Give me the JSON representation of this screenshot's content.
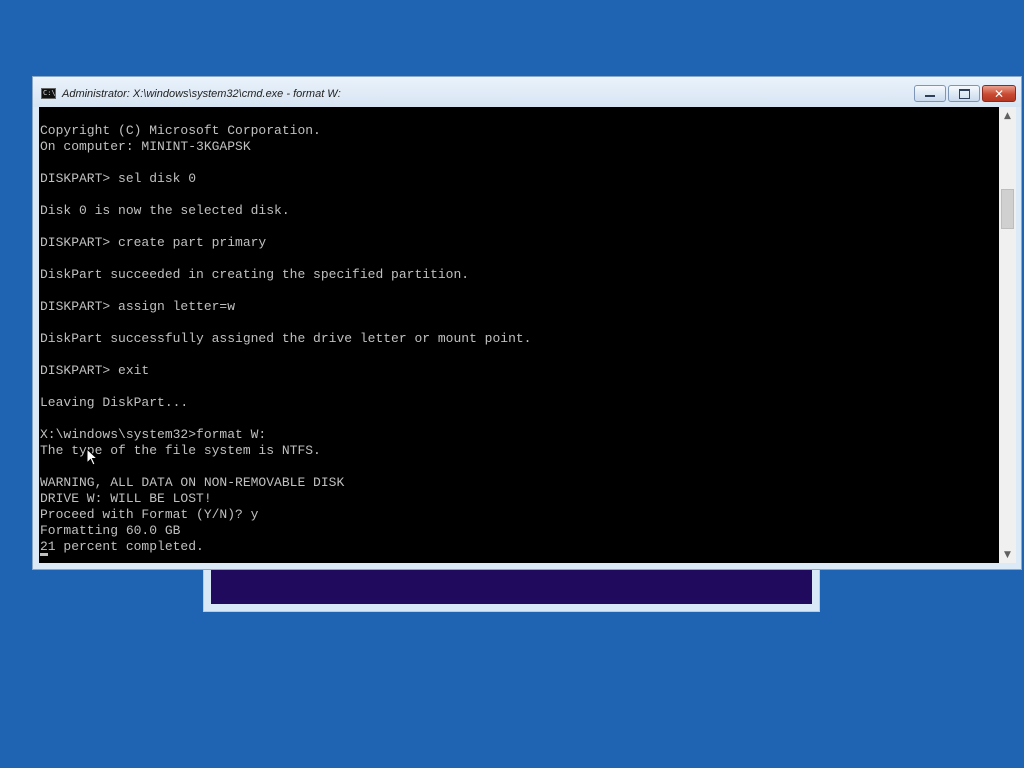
{
  "window": {
    "title": "Administrator: X:\\windows\\system32\\cmd.exe - format  W:",
    "icon_text": "C:\\",
    "buttons": {
      "minimize": "minimize-icon",
      "maximize": "maximize-icon",
      "close": "✕"
    }
  },
  "console": {
    "text": "Copyright (C) Microsoft Corporation.\nOn computer: MININT-3KGAPSK\n\nDISKPART> sel disk 0\n\nDisk 0 is now the selected disk.\n\nDISKPART> create part primary\n\nDiskPart succeeded in creating the specified partition.\n\nDISKPART> assign letter=w\n\nDiskPart successfully assigned the drive letter or mount point.\n\nDISKPART> exit\n\nLeaving DiskPart...\n\nX:\\windows\\system32>format W:\nThe type of the file system is NTFS.\n\nWARNING, ALL DATA ON NON-REMOVABLE DISK\nDRIVE W: WILL BE LOST!\nProceed with Format (Y/N)? y\nFormatting 60.0 GB\n21 percent completed."
  },
  "scrollbar": {
    "up_arrow": "▲",
    "down_arrow": "▼"
  },
  "colors": {
    "desktop": "#1f63b3",
    "console_bg": "#000000",
    "console_fg": "#c0c0c0",
    "setup_window_bg": "#1f0a5e"
  }
}
